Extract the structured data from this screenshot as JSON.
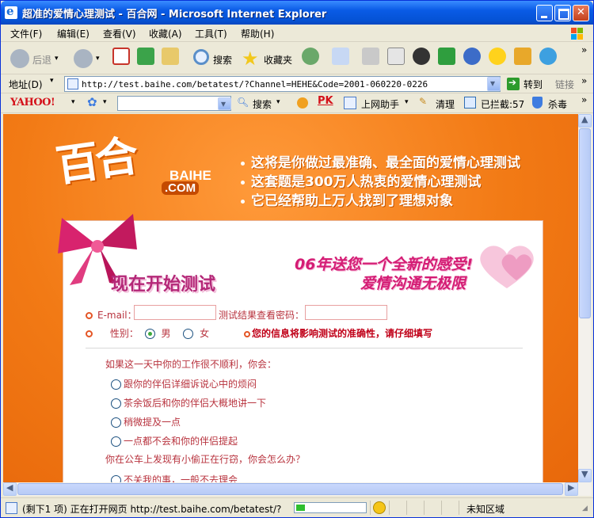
{
  "window": {
    "title": "超准的爱情心理测试 - 百合网 - Microsoft Internet Explorer"
  },
  "menu": [
    "文件(F)",
    "编辑(E)",
    "查看(V)",
    "收藏(A)",
    "工具(T)",
    "帮助(H)"
  ],
  "toolbar": {
    "back_label": "后退",
    "search_label": "搜索",
    "favorites_label": "收藏夹",
    "more": "»"
  },
  "address": {
    "label": "地址(D)",
    "url": "http://test.baihe.com/betatest/?Channel=HEHE&Code=2001-060220-0226",
    "go_label": "转到",
    "links_label": "链接",
    "more": "»"
  },
  "yahoo_bar": {
    "logo": "YAHOO!",
    "search_label": "搜索",
    "pk_label": "PK",
    "helper_label": "上网助手",
    "clean_label": "清理",
    "blocked_label": "已拦截:57",
    "antivirus_label": "杀毒",
    "more": "»"
  },
  "page": {
    "logo_main": "百合",
    "logo_baihe": "BAIHE",
    "logo_com": ".COM",
    "slogans": [
      "这将是你做过最准确、最全面的爱情心理测试",
      "这套题是300万人热衷的爱情心理测试",
      "它已经帮助上万人找到了理想对象"
    ],
    "promo_line1": "06年送您一个全新的感受!",
    "promo_line2": "爱情沟通无极限",
    "start_title": "现在开始测试",
    "email_label": "E-mail：",
    "password_label": "测试结果查看密码：",
    "gender_label": "性别：",
    "gender_male": "男",
    "gender_female": "女",
    "gender_selected": "男",
    "warning": "您的信息将影响测试的准确性，请仔细填写",
    "questions": [
      {
        "text": "如果这一天中你的工作很不顺利，你会：",
        "options": [
          "跟你的伴侣详细诉说心中的烦闷",
          "茶余饭后和你的伴侣大概地讲一下",
          "稍微提及一点",
          "一点都不会和你的伴侣提起"
        ]
      },
      {
        "text": "你在公车上发现有小偷正在行窃，你会怎么办？",
        "options": [
          "不关我的事，一般不去理会"
        ]
      }
    ]
  },
  "status": {
    "text": "(剩下1 项) 正在打开网页 http://test.baihe.com/betatest/?",
    "progress": 0.12,
    "zone": "未知区域"
  },
  "colors": {
    "title_bar": "#0A5BE6",
    "page_orange": "#F27A15",
    "promo_pink": "#D41C74",
    "form_text": "#B8333E",
    "warning_red": "#C00018"
  }
}
